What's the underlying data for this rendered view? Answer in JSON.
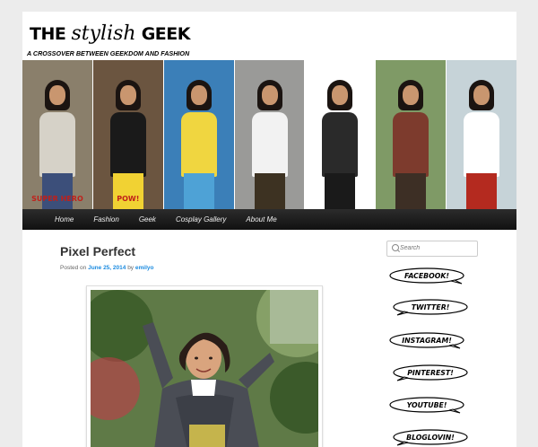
{
  "site": {
    "title_the": "THE",
    "title_script": "stylish",
    "title_geek": "GEEK",
    "tagline": "A CROSSOVER BETWEEN GEEKDOM AND FASHION"
  },
  "banner": {
    "panels": [
      {
        "shirt": "SUPER HERO",
        "bg": "#8a7f6b",
        "top": "#d6d2c8",
        "pants": "#3c4f7a"
      },
      {
        "shirt": "POW!",
        "bg": "#6b5540",
        "top": "#1a1a1a",
        "pants": "#f1d233"
      },
      {
        "shirt": "",
        "bg": "#3b7fb8",
        "top": "#f0d640",
        "pants": "#4ea2d6"
      },
      {
        "shirt": "",
        "bg": "#9a9a98",
        "top": "#f2f2f2",
        "pants": "#3d3222"
      },
      {
        "shirt": "",
        "bg": "#ffffff",
        "top": "#2a2a2a",
        "pants": "#1a1a1a"
      },
      {
        "shirt": "",
        "bg": "#7f9a66",
        "top": "#7d3b2d",
        "pants": "#3d2f25"
      },
      {
        "shirt": "",
        "bg": "#c6d3d8",
        "top": "#ffffff",
        "pants": "#b42a1f"
      }
    ]
  },
  "nav": {
    "items": [
      "Home",
      "Fashion",
      "Geek",
      "Cosplay Gallery",
      "About Me"
    ]
  },
  "post": {
    "title": "Pixel Perfect",
    "meta_posted_on": "Posted on",
    "meta_date": "June 25, 2014",
    "meta_by": "by",
    "meta_author": "emilyo"
  },
  "sidebar": {
    "search_placeholder": "Search",
    "social": [
      "FACEBOOK!",
      "TWITTER!",
      "INSTAGRAM!",
      "PINTEREST!",
      "YOUTUBE!",
      "BLOGLOVIN!"
    ]
  },
  "colors": {
    "accent_link": "#1b8be0",
    "nav_bg": "#1a1a1a"
  }
}
